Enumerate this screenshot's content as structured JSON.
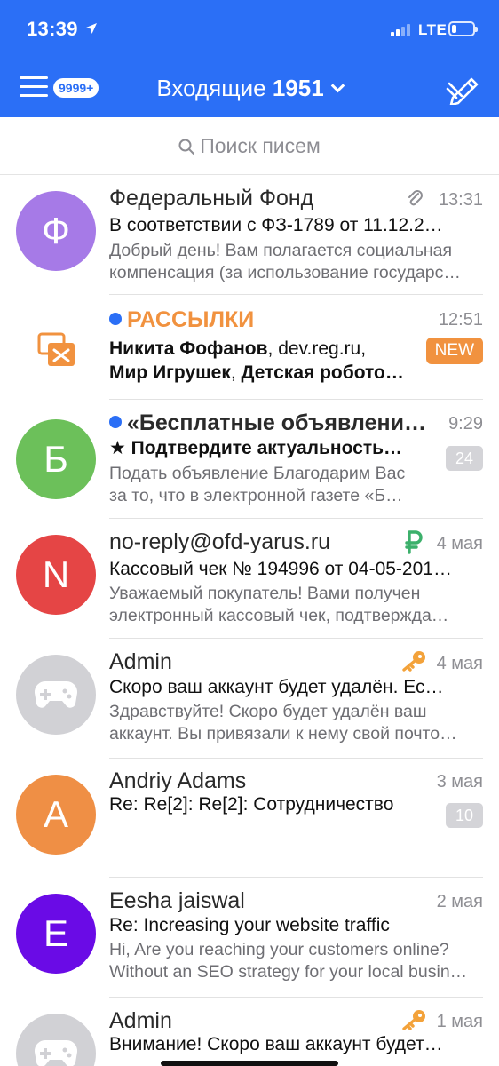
{
  "status_bar": {
    "time": "13:39",
    "network": "LTE"
  },
  "header": {
    "menu_badge": "9999+",
    "folder_name": "Входящие",
    "folder_count": "1951"
  },
  "search": {
    "placeholder": "Поиск писем"
  },
  "colors": {
    "accent": "#2b6ff6",
    "orange": "#f1923f",
    "badge_gray": "#d4d4d8",
    "ruble_green": "#3cb06b",
    "key_orange": "#f3a23a"
  },
  "emails": [
    {
      "avatar_letter": "Ф",
      "avatar_color": "#a67ae7",
      "sender": "Федеральный Фонд",
      "date": "13:31",
      "icon": "paperclip-icon",
      "subject": "В соответствии с ФЗ-1789 от 11.12.2…",
      "preview1": "Добрый день! Вам полагается социальная",
      "preview2": "компенсация (за использование государс…"
    },
    {
      "avatar_icon": "newsletter-icon",
      "sender": "РАССЫЛКИ",
      "date": "12:51",
      "badge": "NEW",
      "line1_a": "Никита Фофанов",
      "line1_b": ", ",
      "line1_c": "dev.reg.ru",
      "line1_d": ",",
      "line2_a": "Мир Игрушек",
      "line2_b": ", ",
      "line2_c": "Детская робото…"
    },
    {
      "avatar_letter": "Б",
      "avatar_color": "#6cc05a",
      "sender": "«Бесплатные объявлени…",
      "date": "9:29",
      "badge": "24",
      "subject": "★ Подтвердите актуальность…",
      "preview1": "Подать объявление Благодарим Вас",
      "preview2": "за то, что в электронной газете «Б…"
    },
    {
      "avatar_letter": "N",
      "avatar_color": "#e54545",
      "sender": "no-reply@ofd-yarus.ru",
      "date": "4 мая",
      "icon": "ruble-icon",
      "subject": "Кассовый чек № 194996 от 04-05-201…",
      "preview1": "Уважаемый покупатель! Вами получен",
      "preview2": "электронный кассовый чек, подтвержда…"
    },
    {
      "avatar_icon": "gamepad-icon",
      "avatar_color": "#d1d1d5",
      "sender": "Admin",
      "date": "4 мая",
      "icon": "key-icon",
      "subject": "Скоро ваш  аккаунт будет удалён. Ес…",
      "preview1": "Здравствуйте! Скоро будет удалён ваш",
      "preview2": "аккаунт. Вы привязали к нему свой почто…"
    },
    {
      "avatar_letter": "A",
      "avatar_color": "#ef8f45",
      "sender": "Andriy Adams",
      "date": "3 мая",
      "badge": "10",
      "subject": "Re: Re[2]: Re[2]: Сотрудничество"
    },
    {
      "avatar_letter": "E",
      "avatar_color": "#6a0be6",
      "sender": "Eesha jaiswal",
      "date": "2 мая",
      "subject": "Re: Increasing your website traffic",
      "preview1": "Hi, Are you reaching your customers online?",
      "preview2": "Without an SEO strategy for your local busin…"
    },
    {
      "avatar_icon": "gamepad-icon",
      "avatar_color": "#d1d1d5",
      "sender": "Admin",
      "date": "1 мая",
      "icon": "key-icon",
      "subject": "Внимание! Скоро ваш  аккаунт будет…"
    }
  ]
}
